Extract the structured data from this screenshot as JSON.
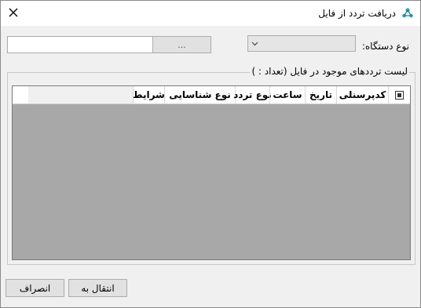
{
  "window": {
    "title": "دریافت تردد از فایل",
    "close_icon": "close-icon",
    "app_icon": "app-icon"
  },
  "device": {
    "label": "نوع دستگاه:",
    "selected": ""
  },
  "file": {
    "path_value": "",
    "browse_label": "..."
  },
  "group": {
    "legend": "لیست ترددهای موجود در فایل (تعداد : )"
  },
  "table": {
    "columns": [
      "کدپرسنلی",
      "تاریخ",
      "ساعت",
      "نوع تردد",
      "نوع شناسایی",
      "شرایط"
    ],
    "rows": []
  },
  "buttons": {
    "transfer_label": "انتقال به",
    "cancel_label": "انصراف"
  },
  "colors": {
    "grid_background": "#a8a8a8",
    "window_background": "#f0f0f0",
    "icon_accent": "#2aa6b8"
  }
}
